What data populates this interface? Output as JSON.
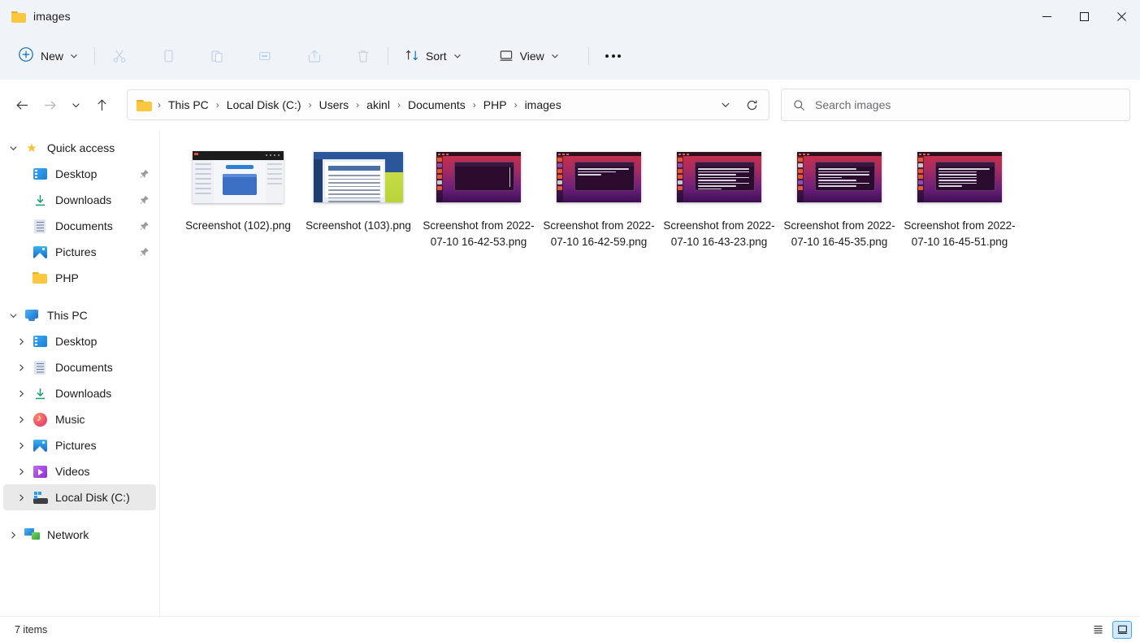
{
  "window": {
    "title": "images",
    "folder_icon": "folder-icon",
    "controls": {
      "minimize": "minimize-icon",
      "maximize": "maximize-icon",
      "close": "close-icon"
    }
  },
  "toolbar": {
    "new_label": "New",
    "new_icon": "plus-circle-icon",
    "cut_icon": "scissors-icon",
    "copy_icon": "copy-icon",
    "paste_icon": "paste-icon",
    "rename_icon": "rename-icon",
    "share_icon": "share-icon",
    "delete_icon": "trash-icon",
    "sort_label": "Sort",
    "sort_icon": "sort-arrows-icon",
    "view_label": "View",
    "view_icon": "monitor-icon",
    "more_label": "See more",
    "more_icon": "ellipsis-icon"
  },
  "navigation": {
    "back_icon": "arrow-left-icon",
    "forward_icon": "arrow-right-icon",
    "recent_icon": "chevron-down-icon",
    "up_icon": "arrow-up-icon",
    "refresh_icon": "refresh-icon",
    "dropdown_icon": "chevron-down-icon",
    "breadcrumbs": [
      "This PC",
      "Local Disk (C:)",
      "Users",
      "akinl",
      "Documents",
      "PHP",
      "images"
    ],
    "separator": "›"
  },
  "search": {
    "placeholder": "Search images",
    "value": "",
    "icon": "search-icon"
  },
  "sidebar": {
    "groups": [
      {
        "name": "Quick access",
        "icon": "star-icon",
        "expanded": true,
        "twisty": "chevron-down-icon",
        "items": [
          {
            "label": "Desktop",
            "icon": "desktop-icon",
            "pinned": true,
            "twisty": "none"
          },
          {
            "label": "Downloads",
            "icon": "download-icon",
            "pinned": true,
            "twisty": "none"
          },
          {
            "label": "Documents",
            "icon": "document-icon",
            "pinned": true,
            "twisty": "none"
          },
          {
            "label": "Pictures",
            "icon": "picture-icon",
            "pinned": true,
            "twisty": "none"
          },
          {
            "label": "PHP",
            "icon": "folder-icon",
            "pinned": false,
            "twisty": "none"
          }
        ]
      },
      {
        "name": "This PC",
        "icon": "pc-icon",
        "expanded": true,
        "twisty": "chevron-down-icon",
        "items": [
          {
            "label": "Desktop",
            "icon": "desktop-icon",
            "pinned": false,
            "twisty": "chevron-right-icon"
          },
          {
            "label": "Documents",
            "icon": "document-icon",
            "pinned": false,
            "twisty": "chevron-right-icon"
          },
          {
            "label": "Downloads",
            "icon": "download-icon",
            "pinned": false,
            "twisty": "chevron-right-icon"
          },
          {
            "label": "Music",
            "icon": "music-icon",
            "pinned": false,
            "twisty": "chevron-right-icon"
          },
          {
            "label": "Pictures",
            "icon": "picture-icon",
            "pinned": false,
            "twisty": "chevron-right-icon"
          },
          {
            "label": "Videos",
            "icon": "video-icon",
            "pinned": false,
            "twisty": "chevron-right-icon"
          },
          {
            "label": "Local Disk (C:)",
            "icon": "disk-icon",
            "pinned": false,
            "twisty": "chevron-right-icon",
            "selected": true
          }
        ]
      },
      {
        "name": "Network",
        "icon": "network-icon",
        "expanded": false,
        "twisty": "chevron-right-icon",
        "items": []
      }
    ]
  },
  "files": [
    {
      "name": "Screenshot (102).png",
      "thumb": "windows-explorer"
    },
    {
      "name": "Screenshot (103).png",
      "thumb": "word-document"
    },
    {
      "name": "Screenshot from 2022-07-10 16-42-53.png",
      "thumb": "ubuntu-empty-terminal"
    },
    {
      "name": "Screenshot from 2022-07-10 16-42-59.png",
      "thumb": "ubuntu-few-lines"
    },
    {
      "name": "Screenshot from 2022-07-10 16-43-23.png",
      "thumb": "ubuntu-listing"
    },
    {
      "name": "Screenshot from 2022-07-10 16-45-35.png",
      "thumb": "ubuntu-text"
    },
    {
      "name": "Screenshot from 2022-07-10 16-45-51.png",
      "thumb": "ubuntu-listing2"
    }
  ],
  "statusbar": {
    "item_count": "7 items",
    "details_view_icon": "list-view-icon",
    "icons_view_icon": "large-icons-view-icon",
    "active_view": "large-icons"
  },
  "colors": {
    "chrome": "#f0f3f7",
    "content": "#ffffff",
    "accent": "#0f6cbd",
    "selection": "#e9e9e9",
    "folder_yellow": "#fac741"
  }
}
